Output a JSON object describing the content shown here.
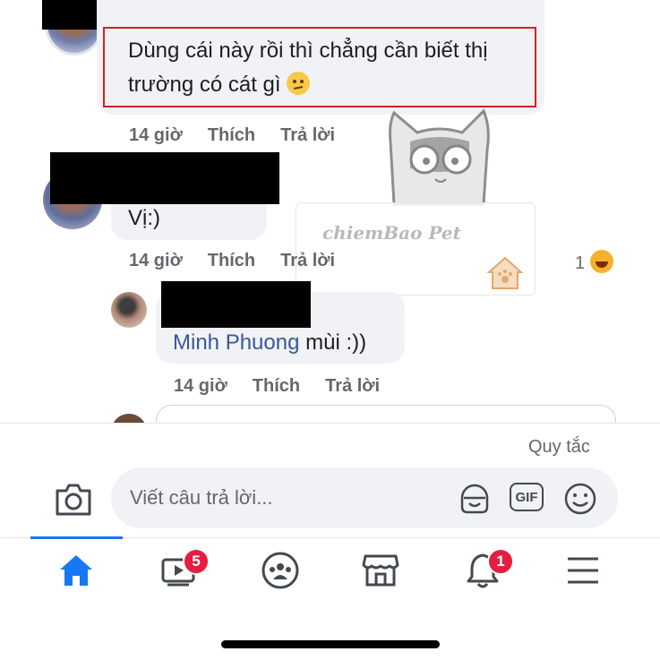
{
  "comments": [
    {
      "text_line1": "Dùng cái này rồi thì chẳng cần biết thị",
      "text_line2": "trường có cát gì",
      "time": "14 giờ",
      "like": "Thích",
      "reply": "Trả lời"
    },
    {
      "text": "Vị:)",
      "time": "14 giờ",
      "like": "Thích",
      "reply": "Trả lời",
      "reaction_count": "1"
    },
    {
      "mention": "Minh Phuong",
      "text": " mùi :))",
      "time": "14 giờ",
      "like": "Thích",
      "reply": "Trả lời"
    }
  ],
  "watermark": {
    "brand": "chiemBao Pet"
  },
  "composer": {
    "rules_link": "Quy tắc",
    "placeholder": "Viết câu trả lời...",
    "gif_label": "GIF"
  },
  "tabbar": {
    "video_badge": "5",
    "notifications_badge": "1"
  },
  "colors": {
    "accent": "#1877f2",
    "mention": "#385898",
    "badge": "#e41e3f",
    "highlight_box": "#d9201d"
  }
}
